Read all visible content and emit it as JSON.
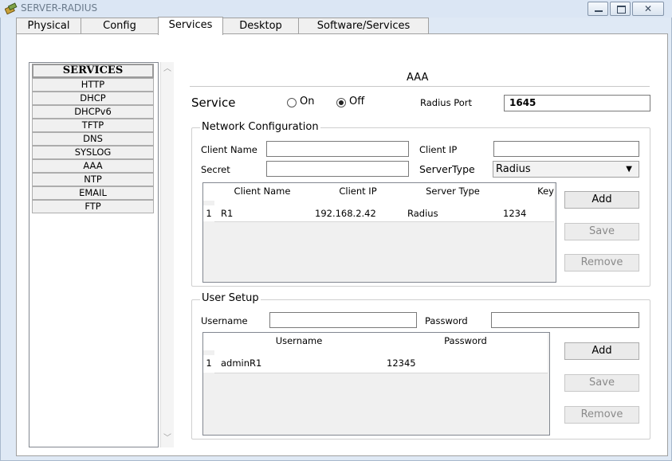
{
  "window": {
    "title": "SERVER-RADIUS"
  },
  "tabs": [
    {
      "label": "Physical"
    },
    {
      "label": "Config"
    },
    {
      "label": "Services"
    },
    {
      "label": "Desktop"
    },
    {
      "label": "Software/Services"
    }
  ],
  "active_tab": "Services",
  "services": {
    "header": "SERVICES",
    "items": [
      "HTTP",
      "DHCP",
      "DHCPv6",
      "TFTP",
      "DNS",
      "SYSLOG",
      "AAA",
      "NTP",
      "EMAIL",
      "FTP"
    ]
  },
  "aaa": {
    "title": "AAA",
    "service_label": "Service",
    "on_label": "On",
    "off_label": "Off",
    "service_state": "Off",
    "radius_port_label": "Radius Port",
    "radius_port_value": "1645",
    "network_config": {
      "legend": "Network Configuration",
      "client_name_label": "Client Name",
      "client_name_value": "",
      "client_ip_label": "Client IP",
      "client_ip_value": "",
      "secret_label": "Secret",
      "secret_value": "",
      "server_type_label": "ServerType",
      "server_type_value": "Radius",
      "columns": [
        "Client Name",
        "Client IP",
        "Server Type",
        "Key"
      ],
      "rows": [
        {
          "num": "1",
          "client_name": "R1",
          "client_ip": "192.168.2.42",
          "server_type": "Radius",
          "key": "1234"
        }
      ],
      "add_label": "Add",
      "save_label": "Save",
      "remove_label": "Remove"
    },
    "user_setup": {
      "legend": "User Setup",
      "username_label": "Username",
      "username_value": "",
      "password_label": "Password",
      "password_value": "",
      "columns": [
        "Username",
        "Password"
      ],
      "rows": [
        {
          "num": "1",
          "username": "adminR1",
          "password": "12345"
        }
      ],
      "add_label": "Add",
      "save_label": "Save",
      "remove_label": "Remove"
    }
  }
}
